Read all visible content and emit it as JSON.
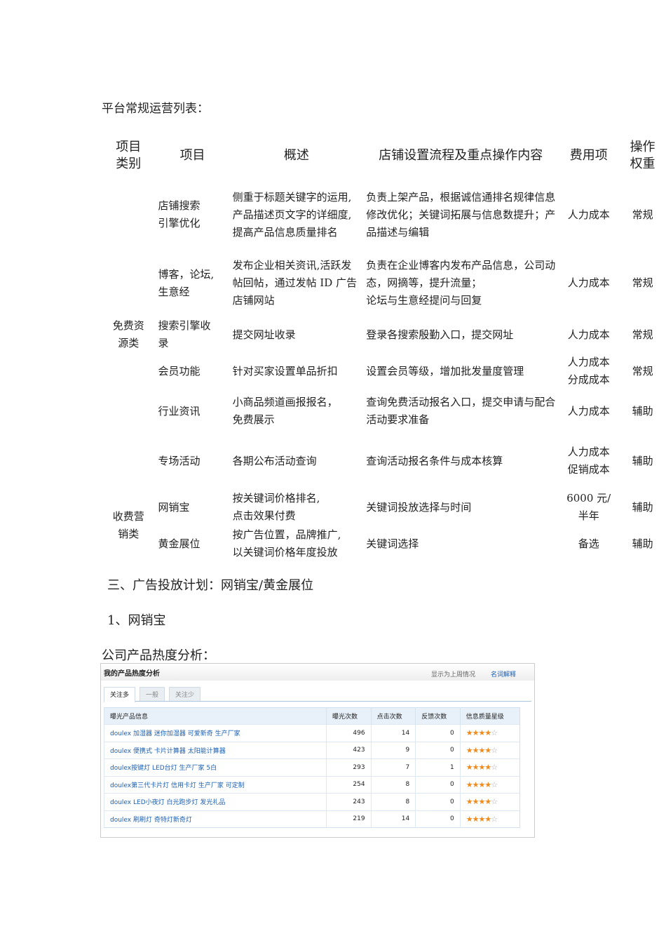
{
  "heading": "平台常规运营列表：",
  "table": {
    "headers": [
      "项目\n类别",
      "项目",
      "概述",
      "店铺设置流程及重点操作内容",
      "费用项",
      "操作\n权重"
    ],
    "groups": [
      {
        "category": "免费资\n源类",
        "rows": [
          {
            "item": "店铺搜索\n引擎优化",
            "summary": "侧重于标题关键字的运用,产品描述页文字的详细度,提高产品信息质量排名",
            "process": "负责上架产品，根据诚信通排名规律信息修改优化；关键词拓展与信息数提升；产品描述与编辑",
            "cost": "人力成本",
            "weight": "常规"
          },
          {
            "item": "博客，论坛,\n生意经",
            "summary": "发布企业相关资讯,活跃发帖回帖，通过发帖 ID 广告店铺网站",
            "process": "负责在企业博客内发布产品信息，公司动态，网摘等，提升流量；\n论坛与生意经提问与回复",
            "cost": "人力成本",
            "weight": "常规"
          },
          {
            "item": "搜索引擎收\n录",
            "summary": "提交网址收录",
            "process": "登录各搜索殷勤入口，提交网址",
            "cost": "人力成本",
            "weight": "常规"
          },
          {
            "item": "会员功能",
            "summary": "针对买家设置单品折扣",
            "process": "设置会员等级，增加批发量度管理",
            "cost": "人力成本\n分成成本",
            "weight": "常规"
          },
          {
            "item": "行业资讯",
            "summary": "小商品频道画报报名，\n免费展示",
            "process": "查询免费活动报名入口，提交申请与配合活动要求准备",
            "cost": "人力成本",
            "weight": "辅助"
          },
          {
            "item": "专场活动",
            "summary": "各期公布活动查询",
            "process": "查询活动报名条件与成本核算",
            "cost": "人力成本\n促销成本",
            "weight": "辅助"
          }
        ]
      },
      {
        "category": "收费营\n销类",
        "rows": [
          {
            "item": "网销宝",
            "summary": "按关键词价格排名,\n点击效果付费",
            "process": "关键词投放选择与时间",
            "cost": "6000 元/\n半年",
            "weight": "辅助"
          },
          {
            "item": "黄金展位",
            "summary": "按广告位置，品牌推广,\n以关键词价格年度投放",
            "process": "关键词选择",
            "cost": "备选",
            "weight": "辅助"
          }
        ]
      }
    ]
  },
  "section3": "三、广告投放计划：网销宝/黄金展位",
  "sub1": "1、网销宝",
  "analysis_heading": "公司产品热度分析：",
  "shot": {
    "title": "我的产品热度分析",
    "period": "显示为上周情况",
    "glossary": "名词解释",
    "tabs": [
      "关注多",
      "一般",
      "关注少"
    ],
    "columns": [
      "曝光产品信息",
      "曝光次数",
      "点击次数",
      "反馈次数",
      "信息质量星级"
    ],
    "rows": [
      {
        "name": "doulex 加湿器 迷你加湿器 可爱新奇 生产厂家",
        "exposure": "496",
        "clicks": "14",
        "feedback": "0",
        "stars": 4
      },
      {
        "name": "doulex 便携式 卡片计算器 太阳能计算器",
        "exposure": "423",
        "clicks": "9",
        "feedback": "0",
        "stars": 4
      },
      {
        "name": "doulex按键灯 LED台灯 生产厂家 5白",
        "exposure": "293",
        "clicks": "7",
        "feedback": "1",
        "stars": 4
      },
      {
        "name": "doulex第三代卡片灯 信用卡灯 生产厂家 可定制",
        "exposure": "254",
        "clicks": "8",
        "feedback": "0",
        "stars": 4
      },
      {
        "name": "doulex LED小夜灯 白光跑步灯 发光礼品",
        "exposure": "243",
        "clicks": "8",
        "feedback": "0",
        "stars": 4
      },
      {
        "name": "doulex 刷刷灯 奇特灯新奇灯",
        "exposure": "219",
        "clicks": "14",
        "feedback": "0",
        "stars": 4
      }
    ]
  }
}
